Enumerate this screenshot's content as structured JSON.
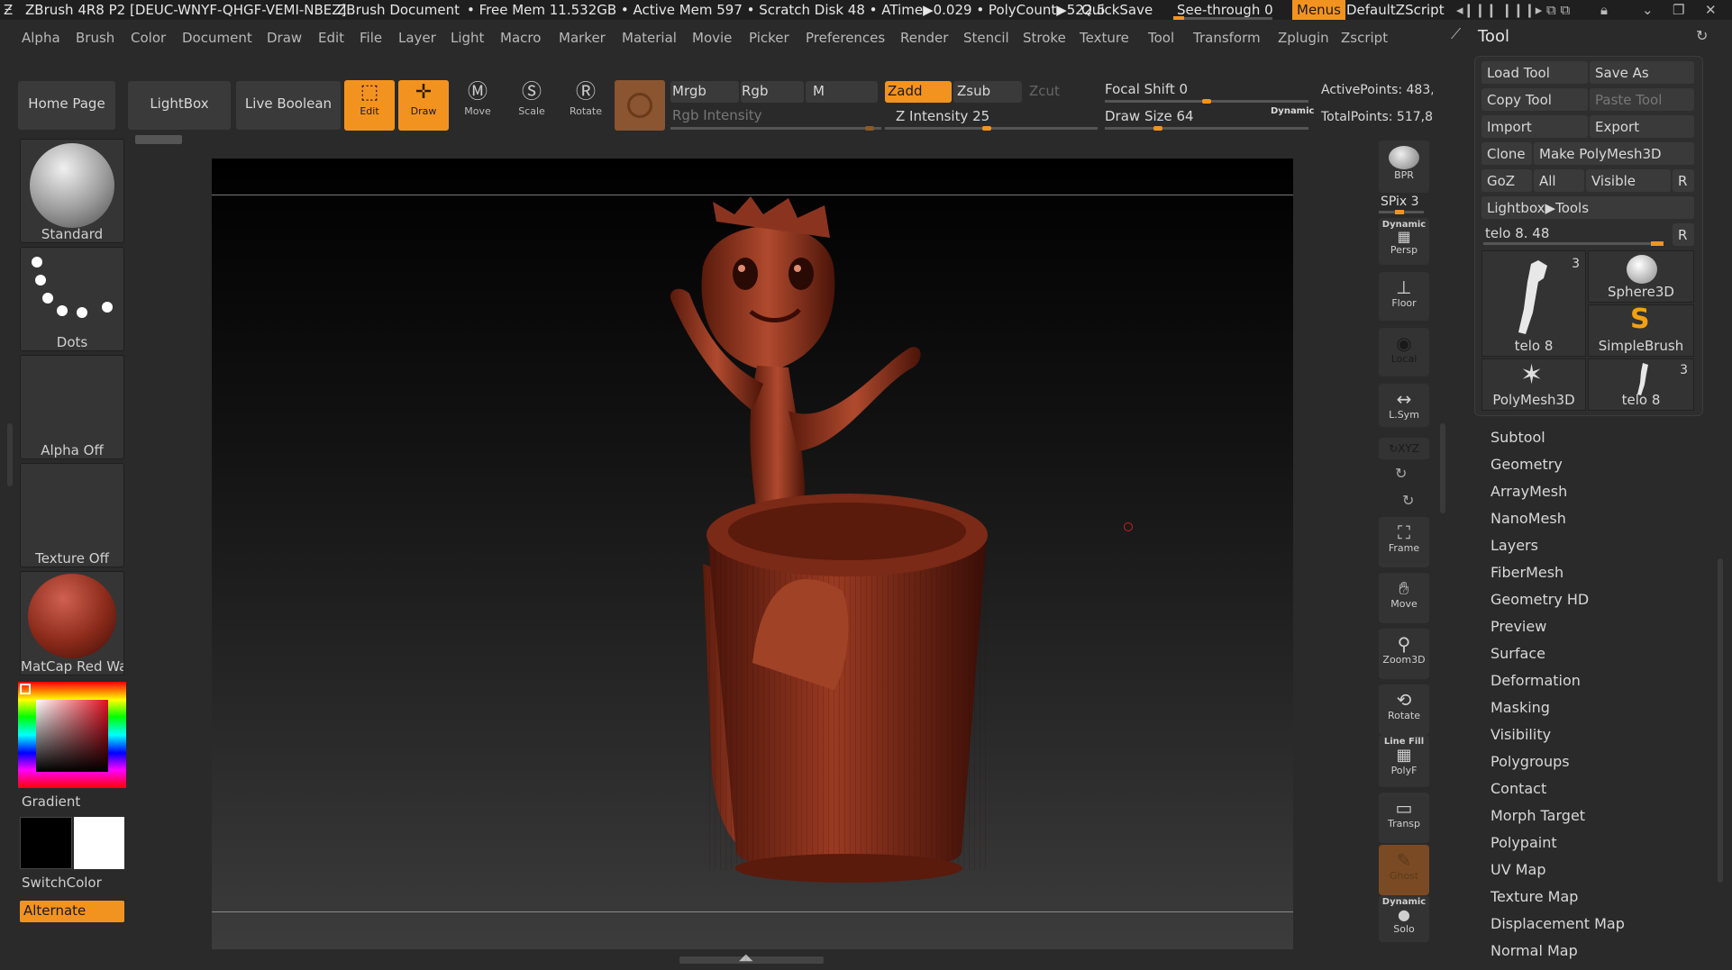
{
  "titlebar": {
    "app": "ZBrush 4R8 P2 [DEUC-WNYF-QHGF-VEMI-NBEZ]",
    "doc": "ZBrush Document",
    "mem": "• Free Mem 11.532GB • Active Mem 597 • Scratch Disk 48 • ATime▶0.029 • PolyCount▶522.5",
    "quicksave": "QuickSave",
    "seethrough": "See-through  0",
    "menus": "Menus",
    "script": "DefaultZScript"
  },
  "menu": [
    "Alpha",
    "Brush",
    "Color",
    "Document",
    "Draw",
    "Edit",
    "File",
    "Layer",
    "Light",
    "Macro",
    "Marker",
    "Material",
    "Movie",
    "Picker",
    "Preferences",
    "Render",
    "Stencil",
    "Stroke",
    "Texture",
    "Tool",
    "Transform",
    "Zplugin",
    "Zscript"
  ],
  "toolbar": {
    "home": "Home Page",
    "lightbox": "LightBox",
    "liveboolean": "Live Boolean",
    "edit": "Edit",
    "draw": "Draw",
    "move": "Move",
    "scale": "Scale",
    "rotate": "Rotate",
    "mrgb": "Mrgb",
    "rgb": "Rgb",
    "m": "M",
    "rgb_intensity": "Rgb Intensity",
    "zadd": "Zadd",
    "zsub": "Zsub",
    "zcut": "Zcut",
    "z_intensity": "Z Intensity 25",
    "focal_shift": "Focal Shift 0",
    "draw_size": "Draw Size 64",
    "dynamic": "Dynamic",
    "active_points": "ActivePoints: 483,",
    "total_points": "TotalPoints: 517,8"
  },
  "left": {
    "brush": "Standard",
    "stroke": "Dots",
    "alpha": "Alpha Off",
    "texture": "Texture Off",
    "material": "MatCap Red Wax",
    "gradient": "Gradient",
    "switchcolor": "SwitchColor",
    "alternate": "Alternate"
  },
  "right_shelf": {
    "bpr": "BPR",
    "spix": "SPix 3",
    "persp": "Persp",
    "dynamic": "Dynamic",
    "floor": "Floor",
    "local": "Local",
    "lsym": "L.Sym",
    "xyz": "XYZ",
    "frame": "Frame",
    "move": "Move",
    "zoom3d": "Zoom3D",
    "rotate": "Rotate",
    "linefill": "Line Fill",
    "polyf": "PolyF",
    "transp": "Transp",
    "ghost": "Ghost",
    "solo": "Solo"
  },
  "tool_panel": {
    "title": "Tool",
    "load": "Load Tool",
    "saveas": "Save As",
    "copy": "Copy Tool",
    "paste": "Paste Tool",
    "import": "Import",
    "export": "Export",
    "clone": "Clone",
    "makepoly": "Make PolyMesh3D",
    "goz": "GoZ",
    "all": "All",
    "visible": "Visible",
    "r": "R",
    "lightbox_tools": "Lightbox▶Tools",
    "current": "telo 8. 48",
    "thumbs": [
      {
        "label": "telo 8",
        "count": "3"
      },
      {
        "label": "Sphere3D",
        "count": ""
      },
      {
        "label": "SimpleBrush",
        "count": ""
      },
      {
        "label": "PolyMesh3D",
        "count": ""
      },
      {
        "label": "telo 8",
        "count": "3"
      }
    ],
    "subpalettes": [
      "Subtool",
      "Geometry",
      "ArrayMesh",
      "NanoMesh",
      "Layers",
      "FiberMesh",
      "Geometry HD",
      "Preview",
      "Surface",
      "Deformation",
      "Masking",
      "Visibility",
      "Polygroups",
      "Contact",
      "Morph Target",
      "Polypaint",
      "UV Map",
      "Texture Map",
      "Displacement Map",
      "Normal Map"
    ]
  }
}
